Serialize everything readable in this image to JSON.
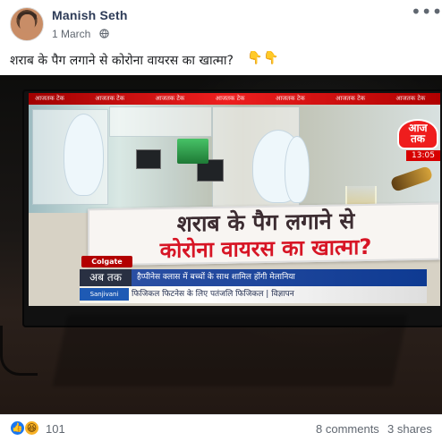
{
  "post": {
    "author": "Manish Seth",
    "date": "1 March",
    "text": "शराब के पैग लगाने से कोरोना वायरस का खात्मा?",
    "emoji": [
      "👇",
      "👇"
    ],
    "icons": {
      "audience": "globe-icon",
      "more": "more-options-icon",
      "like": "like-reaction-icon",
      "haha": "haha-reaction-icon"
    }
  },
  "media": {
    "top_bar": [
      "आजतक टेक",
      "आजतक टेक",
      "आजतक टेक",
      "आजतक टेक",
      "आजतक टेक",
      "आजतक टेक",
      "आजतक टेक"
    ],
    "channel": {
      "logo_line1": "आज",
      "logo_line2": "तक",
      "time": "13:05"
    },
    "headline": {
      "line1": "शराब के पैग लगाने से",
      "line2": "कोरोना वायरस का खात्मा?"
    },
    "ad_tag": "Colgate",
    "ticker": {
      "label": "अब तक",
      "text": "हैप्पीनेस क्लास में बच्चों के साथ शामिल होंगी मेलानिया",
      "bottom_brand": "Sanjivani",
      "bottom_text": "फिजिकल फिटनेस के लिए पतंजलि फिजिकल | विज्ञापन"
    }
  },
  "engagement": {
    "reactions_count": "101",
    "comments": "8 comments",
    "shares": "3 shares"
  }
}
